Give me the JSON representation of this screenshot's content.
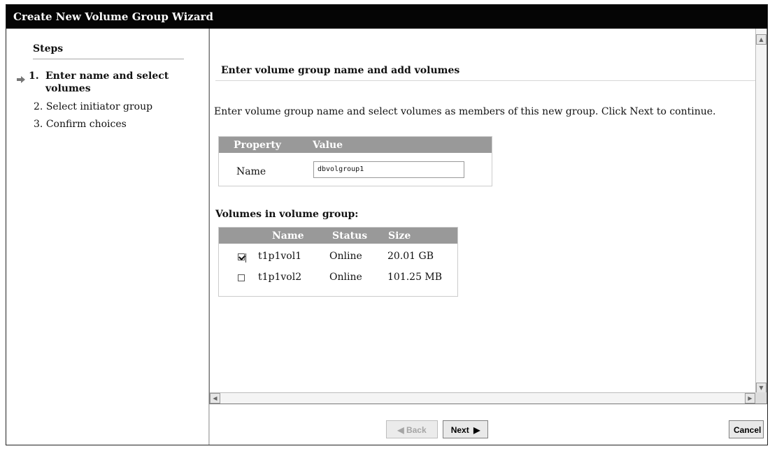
{
  "window": {
    "title": "Create New Volume Group Wizard"
  },
  "steps": {
    "title": "Steps",
    "items": [
      {
        "number": "1.",
        "label_line1": "Enter name and select",
        "label_line2": "volumes"
      },
      {
        "number": "2.",
        "label": "Select initiator group"
      },
      {
        "number": "3.",
        "label": "Confirm choices"
      }
    ]
  },
  "content": {
    "heading": "Enter volume group name and add volumes",
    "instruction": "Enter volume group name and select volumes as members of this new group. Click Next to continue.",
    "property_table": {
      "headers": [
        "Property",
        "Value"
      ],
      "row_label": "Name",
      "name_value": "dbvolgroup1"
    },
    "volumes_title": "Volumes in volume group:",
    "volume_table": {
      "headers": [
        "Name",
        "Status",
        "Size"
      ],
      "rows": [
        {
          "checked": true,
          "name": "t1p1vol1",
          "status": "Online",
          "size": "20.01 GB"
        },
        {
          "checked": false,
          "name": "t1p1vol2",
          "status": "Online",
          "size": "101.25 MB"
        }
      ]
    }
  },
  "buttons": {
    "back": "Back",
    "next": "Next",
    "cancel": "Cancel"
  },
  "icons": {
    "current_step": "right-arrow-icon",
    "back": "left-arrow-icon",
    "next": "right-arrow-icon"
  }
}
